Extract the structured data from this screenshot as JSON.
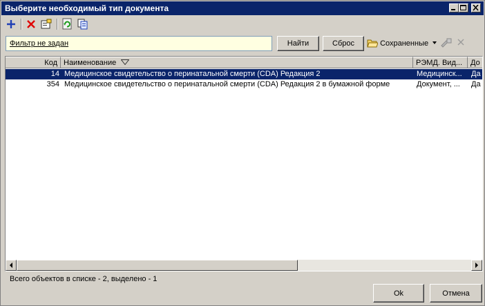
{
  "window": {
    "title": "Выберите необходимый тип документа"
  },
  "filter": {
    "link_text": "Фильтр не задан"
  },
  "buttons": {
    "find": "Найти",
    "reset": "Сброс",
    "saved": "Сохраненные",
    "ok": "Ok",
    "cancel": "Отмена"
  },
  "table": {
    "columns": [
      "Код",
      "Наименование",
      "РЭМД. Вид...",
      "До"
    ],
    "rows": [
      {
        "code": "14",
        "name": "Медицинское свидетельство о перинатальной смерти (CDA) Редакция 2",
        "remd": "Медицинск...",
        "extra": "Да",
        "selected": true
      },
      {
        "code": "354",
        "name": "Медицинское свидетельство о перинатальной смерти (CDA) Редакция 2 в бумажной форме",
        "remd": "Документ, ...",
        "extra": "Да",
        "selected": false
      }
    ]
  },
  "status": "Всего объектов в списке - 2, выделено - 1",
  "icons": [
    "add-icon",
    "delete-icon",
    "properties-icon",
    "refresh-icon",
    "copy-icon",
    "saved-folder-icon",
    "dropdown-arrow-icon",
    "saved-settings-icon",
    "clear-icon",
    "sort-desc-icon"
  ],
  "colors": {
    "titlebar": "#0a246a",
    "selection": "#0a246a",
    "filter_bg": "#ffffe1",
    "chrome": "#d4d0c8"
  }
}
